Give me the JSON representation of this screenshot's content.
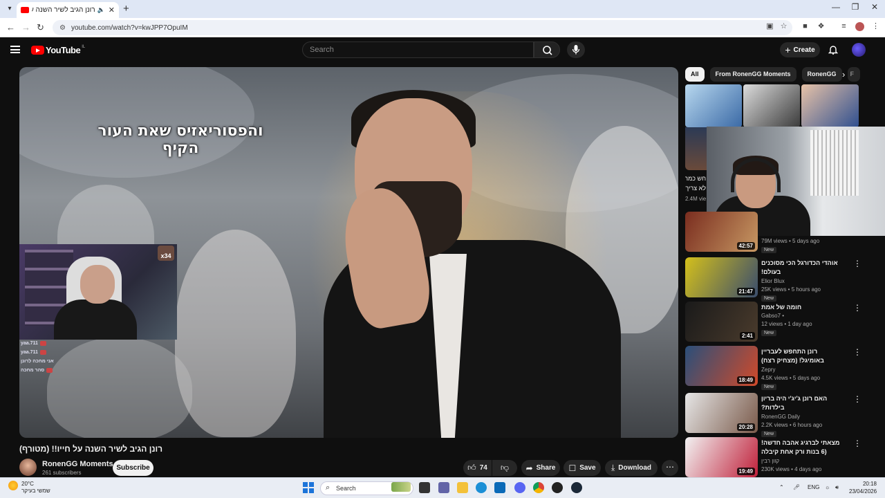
{
  "browser": {
    "tab_title": "רונן הגיב לשיר השנה על ח",
    "url": "youtube.com/watch?v=kwJPP7OpuIM"
  },
  "yt": {
    "logo": "YouTube",
    "country": "IL",
    "search_placeholder": "Search",
    "create_label": "Create"
  },
  "video": {
    "overlay_text": "והפסוריאזיס שאת העור הקיף",
    "stream_sub_count": "x34",
    "chat_lines": [
      "yaa.711",
      "yaa.711",
      "אני מחכה לרונן",
      "סהר מחכה"
    ],
    "title": "רונן הגיב לשיר השנה על חייו!! (מטורף)",
    "channel": "RonenGG Moments",
    "subscribers": "261 subscribers",
    "subscribe_label": "Subscribe",
    "likes": "74",
    "share_label": "Share",
    "save_label": "Save",
    "download_label": "Download"
  },
  "chips": [
    "All",
    "From RonenGG Moments",
    "RonenGG",
    "F"
  ],
  "partial_rec": {
    "text1": "חש כמה",
    "text2": "לא צריך",
    "views": "2.4M views"
  },
  "recommendations": [
    {
      "title": "",
      "channel": "",
      "meta": "79M views • 5 days ago",
      "badge": "New",
      "duration": "42:57",
      "thumb_a": "#7a2d1f",
      "thumb_b": "#c79863"
    },
    {
      "title": "אוהדי הכדורגל הכי מסוכנים בעולם!",
      "channel": "Elior Blux",
      "meta": "25K views • 5 hours ago",
      "badge": "New",
      "duration": "21:47",
      "thumb_a": "#d4c01b",
      "thumb_b": "#3a4d6d"
    },
    {
      "title": "חומה של אמת",
      "channel": "Gabso7 •",
      "meta": "12 views • 1 day ago",
      "badge": "New",
      "duration": "2:41",
      "thumb_a": "#1a1a1a",
      "thumb_b": "#4a3b2c"
    },
    {
      "title": "רונן התחפש לעבריין באומיגל! (מצחיק רצח)",
      "channel": "Zepry",
      "meta": "4.5K views • 5 days ago",
      "badge": "New",
      "duration": "18:49",
      "thumb_a": "#2a4f7a",
      "thumb_b": "#d04a2a"
    },
    {
      "title": "האם רונן ג'יג'י היה בריון בילדות?",
      "channel": "RonenGG Daily",
      "meta": "2.2K views • 6 hours ago",
      "badge": "New",
      "duration": "20:28",
      "thumb_a": "#e6e6e6",
      "thumb_b": "#7a5a4a"
    },
    {
      "title": "מצאתי לברגיג אהבה חדשה! (6 בנות ורק אחת קיבלה נשיקה)",
      "channel": "קוון רבין",
      "meta": "230K views • 4 days ago",
      "badge": "",
      "duration": "19:49",
      "thumb_a": "#f2f2f2",
      "thumb_b": "#c0203a"
    }
  ],
  "taskbar": {
    "temp": "20°C",
    "weather_desc": "שמשי בעיקר",
    "search_label": "Search",
    "lang": "ENG",
    "time": "20:18",
    "date": "23/04/2026"
  },
  "colors": {
    "accent": "#ff0000",
    "bg": "#0f0f0f"
  }
}
